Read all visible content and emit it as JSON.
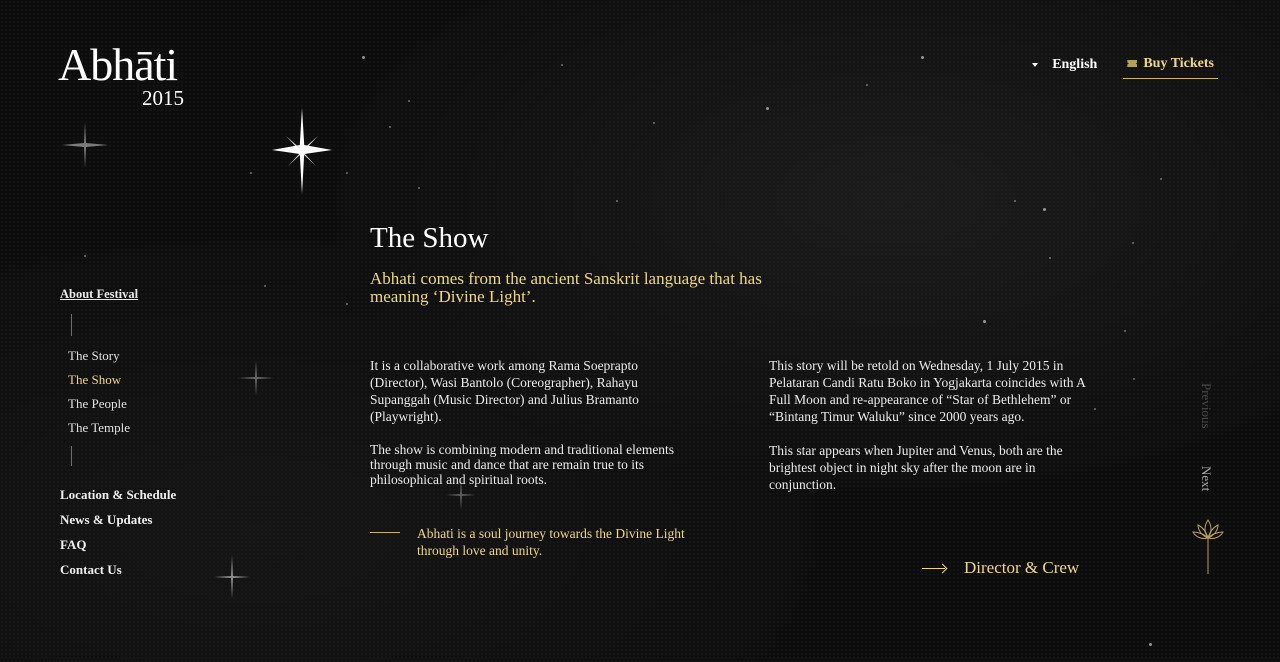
{
  "header": {
    "logo_word": "Abhāti",
    "logo_year": "2015",
    "language": "English",
    "tickets_label": "Buy Tickets"
  },
  "sidebar": {
    "section": "About Festival",
    "sub_items": [
      {
        "label": "The Story",
        "active": false
      },
      {
        "label": "The Show",
        "active": true
      },
      {
        "label": "The People",
        "active": false
      },
      {
        "label": "The Temple",
        "active": false
      }
    ],
    "main_items": [
      {
        "label": "Location & Schedule"
      },
      {
        "label": "News & Updates"
      },
      {
        "label": "FAQ"
      },
      {
        "label": "Contact Us"
      }
    ]
  },
  "main": {
    "title": "The Show",
    "lead": "Abhati comes from the ancient Sanskrit language that has meaning ‘Divine Light’.",
    "col1": [
      "It is a collaborative work among Rama Soeprapto (Director), Wasi Bantolo (Coreographer), Rahayu Supanggah (Music Director) and Julius Bramanto (Playwright).",
      "The show is combining modern and traditional elements through music and dance that are remain true to its philosophical and spiritual roots."
    ],
    "quote": "Abhati is a soul journey towards the Divine Light through love and unity.",
    "col2": [
      "This story will be retold on Wednesday, 1 July 2015 in Pelataran Candi Ratu Boko in Yogjakarta coincides with A Full Moon and re-appearance of “Star of Bethlehem” or “Bintang Timur Waluku” since 2000 years ago.",
      "This star appears when Jupiter and Venus, both are the brightest object in night sky after the moon are in conjunction."
    ],
    "crew_link": "Director & Crew"
  },
  "pager": {
    "previous": "Previous",
    "next": "Next"
  },
  "colors": {
    "accent": "#f0d87f",
    "background": "#0d0d0d",
    "text": "#ececec"
  },
  "icons": [
    "sparkle-icon",
    "caret-down-icon",
    "ticket-icon",
    "arrow-right-icon",
    "lotus-icon"
  ]
}
